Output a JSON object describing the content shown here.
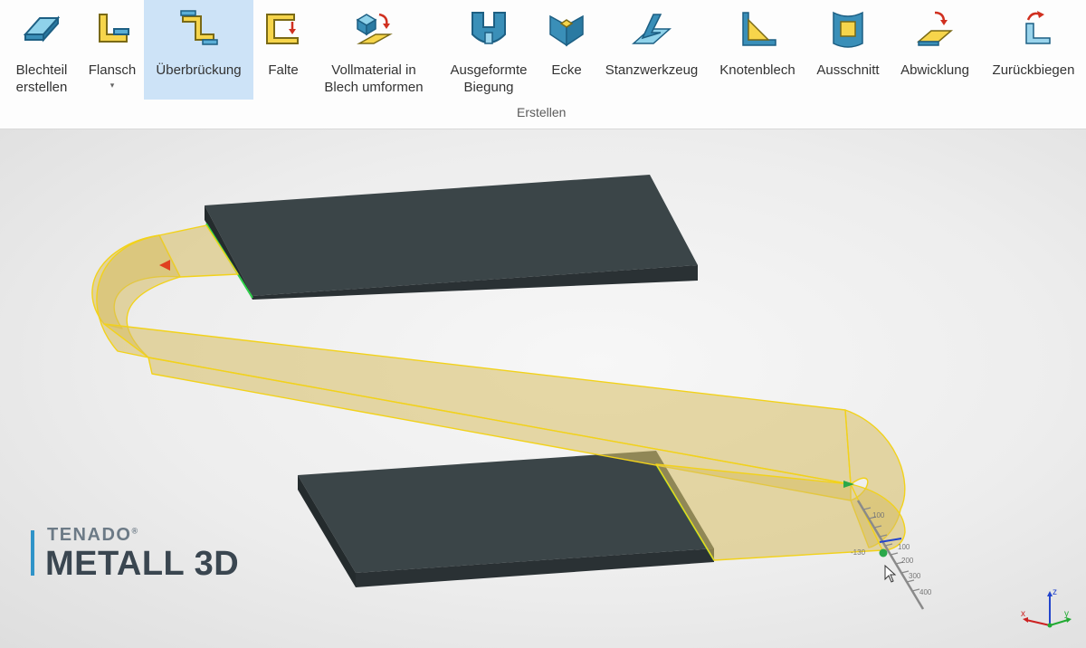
{
  "ribbon": {
    "tools": [
      {
        "label": "Blechteil\nerstellen",
        "icon": "sheet-metal-icon",
        "dropdown": true
      },
      {
        "label": "Flansch",
        "icon": "flange-icon",
        "dropdown": true
      },
      {
        "label": "Überbrückung",
        "icon": "bridge-icon",
        "active": true
      },
      {
        "label": "Falte",
        "icon": "fold-icon"
      },
      {
        "label": "Vollmaterial in\nBlech umformen",
        "icon": "convert-solid-icon"
      },
      {
        "label": "Ausgeformte\nBiegung",
        "icon": "formed-bend-icon"
      },
      {
        "label": "Ecke",
        "icon": "corner-icon"
      },
      {
        "label": "Stanzwerkzeug",
        "icon": "punch-tool-icon"
      },
      {
        "label": "Knotenblech",
        "icon": "gusset-icon"
      },
      {
        "label": "Ausschnitt",
        "icon": "cutout-icon"
      },
      {
        "label": "Abwicklung",
        "icon": "unfold-icon"
      },
      {
        "label": "Zurückbiegen",
        "icon": "refold-icon"
      }
    ],
    "group_label": "Erstellen"
  },
  "viewport": {
    "ruler_labels": [
      "100",
      "-130",
      "100",
      "200",
      "300",
      "400"
    ],
    "axis_labels": {
      "z": "z",
      "x": "x",
      "y": "y"
    }
  },
  "brand": {
    "line1": "TENADO",
    "registered": "®",
    "line2": "METALL 3D"
  },
  "colors": {
    "accent": "#cde3f7",
    "plate": "#3b4548",
    "bridge": "#d7bd63",
    "edge_highlight": "#f2d21a",
    "brand_blue": "#2f93c8"
  }
}
